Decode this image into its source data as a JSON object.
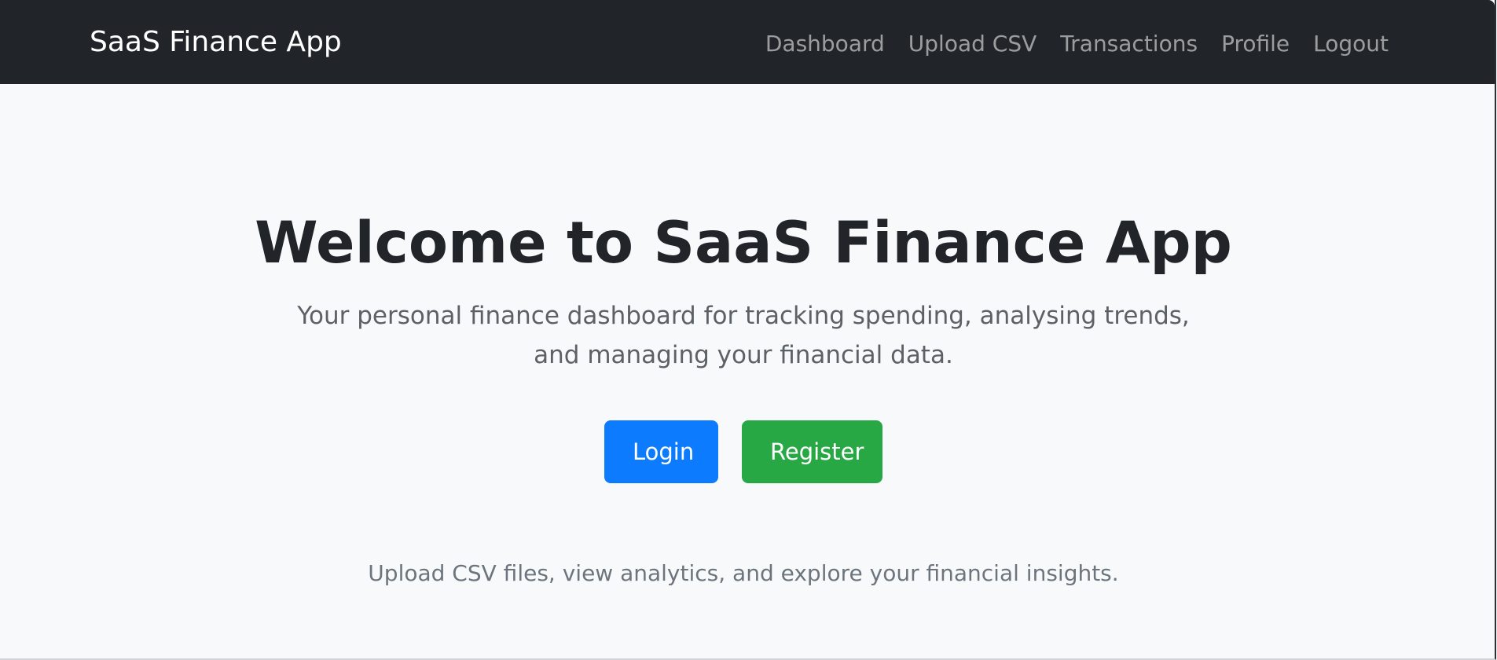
{
  "navbar": {
    "brand": "SaaS Finance App",
    "links": [
      {
        "label": "Dashboard"
      },
      {
        "label": "Upload CSV"
      },
      {
        "label": "Transactions"
      },
      {
        "label": "Profile"
      },
      {
        "label": "Logout"
      }
    ]
  },
  "hero": {
    "title": "Welcome to SaaS Finance App",
    "lead": "Your personal finance dashboard for tracking spending, analysing trends, and managing your financial data.",
    "buttons": {
      "login": "Login",
      "register": "Register"
    },
    "note": "Upload CSV files, view analytics, and explore your financial insights."
  },
  "colors": {
    "navbar_bg": "#212529",
    "page_bg": "#f8f9fa",
    "primary": "#0d7bfd",
    "success": "#28a745"
  }
}
